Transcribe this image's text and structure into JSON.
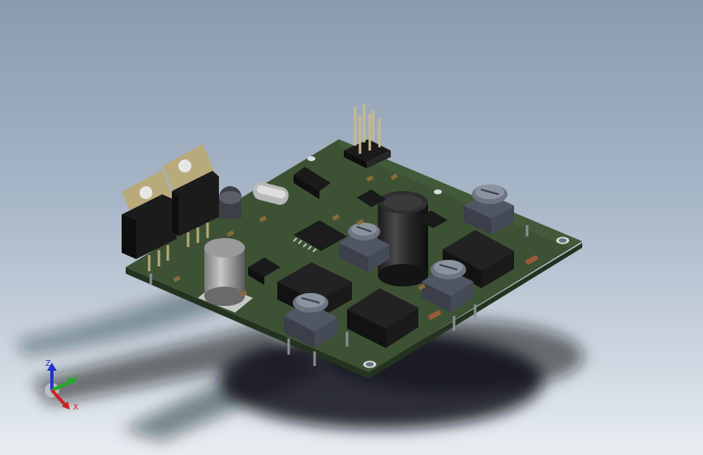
{
  "viewport": {
    "background_top": "#8a9bb0",
    "background_bottom": "#e8edf2"
  },
  "model": {
    "board_color": "#3d5234",
    "board_edge_color": "#2a3a24",
    "component_black": "#1c1c1c",
    "metal_color": "#c9b98a"
  },
  "triad": {
    "z_label": "Z",
    "y_label": "Y",
    "x_label": "X",
    "z_color": "#2233cc",
    "y_color": "#22aa22",
    "x_color": "#cc2222"
  }
}
